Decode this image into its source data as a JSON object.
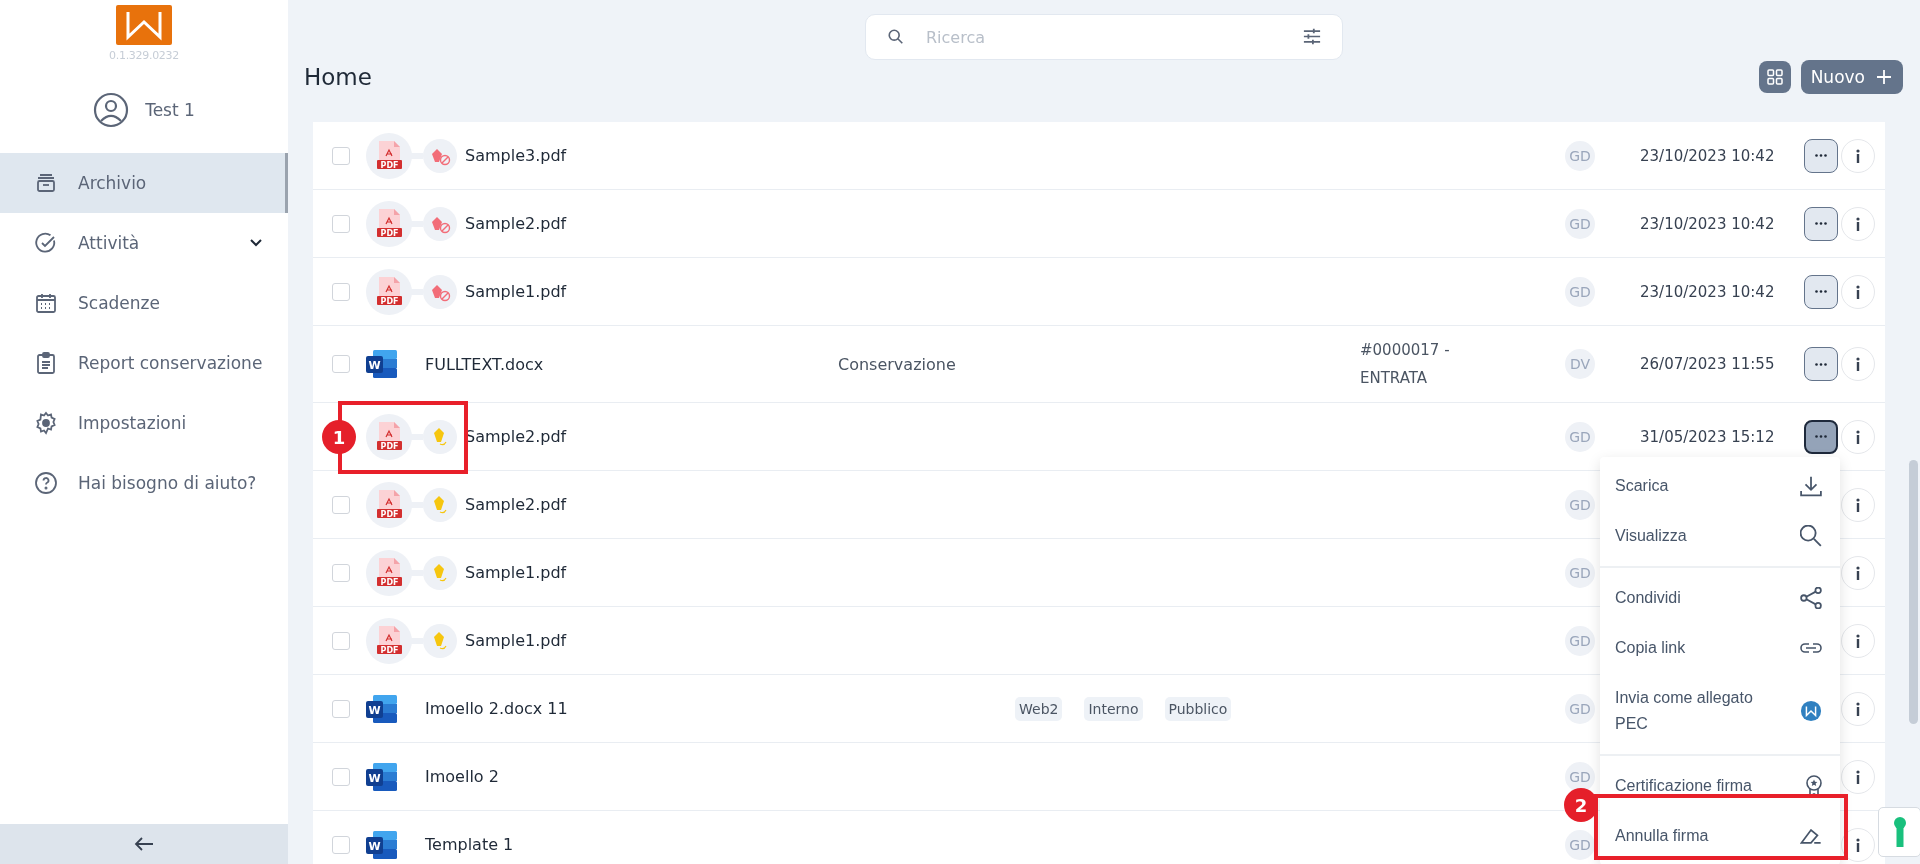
{
  "sidebar": {
    "version": "0.1.329.0232",
    "user": "Test 1",
    "items": [
      {
        "label": "Archivio",
        "kind": "archive",
        "selected": true,
        "has_submenu": false
      },
      {
        "label": "Attività",
        "kind": "tasks",
        "selected": false,
        "has_submenu": true
      },
      {
        "label": "Scadenze",
        "kind": "calendar",
        "selected": false,
        "has_submenu": false
      },
      {
        "label": "Report conservazione",
        "kind": "report",
        "selected": false,
        "has_submenu": false
      },
      {
        "label": "Impostazioni",
        "kind": "settings",
        "selected": false,
        "has_submenu": false
      },
      {
        "label": "Hai bisogno di aiuto?",
        "kind": "help",
        "selected": false,
        "has_submenu": false
      }
    ]
  },
  "search": {
    "placeholder": "Ricerca"
  },
  "page_title": "Home",
  "new_button": "Nuovo",
  "rows": [
    {
      "name": "Sample3.pdf",
      "kind": "pdf",
      "type_label": "PDF",
      "signed": false,
      "checked": false,
      "owner": "GD",
      "date": "23/10/2023 10:42",
      "menu_open": false
    },
    {
      "name": "Sample2.pdf",
      "kind": "pdf",
      "type_label": "PDF",
      "signed": false,
      "checked": false,
      "owner": "GD",
      "date": "23/10/2023 10:42",
      "menu_open": false
    },
    {
      "name": "Sample1.pdf",
      "kind": "pdf",
      "type_label": "PDF",
      "signed": false,
      "checked": false,
      "owner": "GD",
      "date": "23/10/2023 10:42",
      "menu_open": false
    },
    {
      "name": "FULLTEXT.docx",
      "kind": "word",
      "type_label": "W",
      "checked": false,
      "category": "Conservazione",
      "protocol": "#0000017 - ENTRATA",
      "owner": "DV",
      "date": "26/07/2023 11:55",
      "menu_open": false
    },
    {
      "name": "Sample2.pdf",
      "kind": "pdf",
      "type_label": "PDF",
      "signed": true,
      "owner": "GD",
      "date": "31/05/2023 15:12",
      "menu_open": true
    },
    {
      "name": "Sample2.pdf",
      "kind": "pdf",
      "type_label": "PDF",
      "signed": true,
      "checked": false,
      "owner": "GD"
    },
    {
      "name": "Sample1.pdf",
      "kind": "pdf",
      "type_label": "PDF",
      "signed": true,
      "checked": false,
      "owner": "GD"
    },
    {
      "name": "Sample1.pdf",
      "kind": "pdf",
      "type_label": "PDF",
      "signed": true,
      "checked": false,
      "owner": "GD"
    },
    {
      "name": "Imoello 2.docx 11",
      "kind": "word",
      "type_label": "W",
      "checked": false,
      "tags": [
        "Web2",
        "Interno",
        "Pubblico"
      ],
      "owner": "GD"
    },
    {
      "name": "Imoello 2",
      "kind": "word",
      "type_label": "W",
      "checked": false,
      "owner": "GD"
    },
    {
      "name": "Template 1",
      "kind": "word",
      "type_label": "W",
      "checked": false,
      "owner": "GD"
    }
  ],
  "context_menu": [
    {
      "label": "Scarica",
      "kind": "download",
      "divider_before": false
    },
    {
      "label": "Visualizza",
      "kind": "view",
      "divider_before": false
    },
    {
      "label": "Condividi",
      "kind": "share",
      "divider_before": true
    },
    {
      "label": "Copia link",
      "kind": "link",
      "divider_before": false
    },
    {
      "label": "Invia come allegato PEC",
      "kind": "pec",
      "divider_before": false
    },
    {
      "label": "Certificazione firma",
      "kind": "certify",
      "divider_before": true
    },
    {
      "label": "Annulla firma",
      "kind": "unsign",
      "divider_before": false
    }
  ],
  "annotations": [
    {
      "label": "1"
    },
    {
      "label": "2"
    }
  ]
}
